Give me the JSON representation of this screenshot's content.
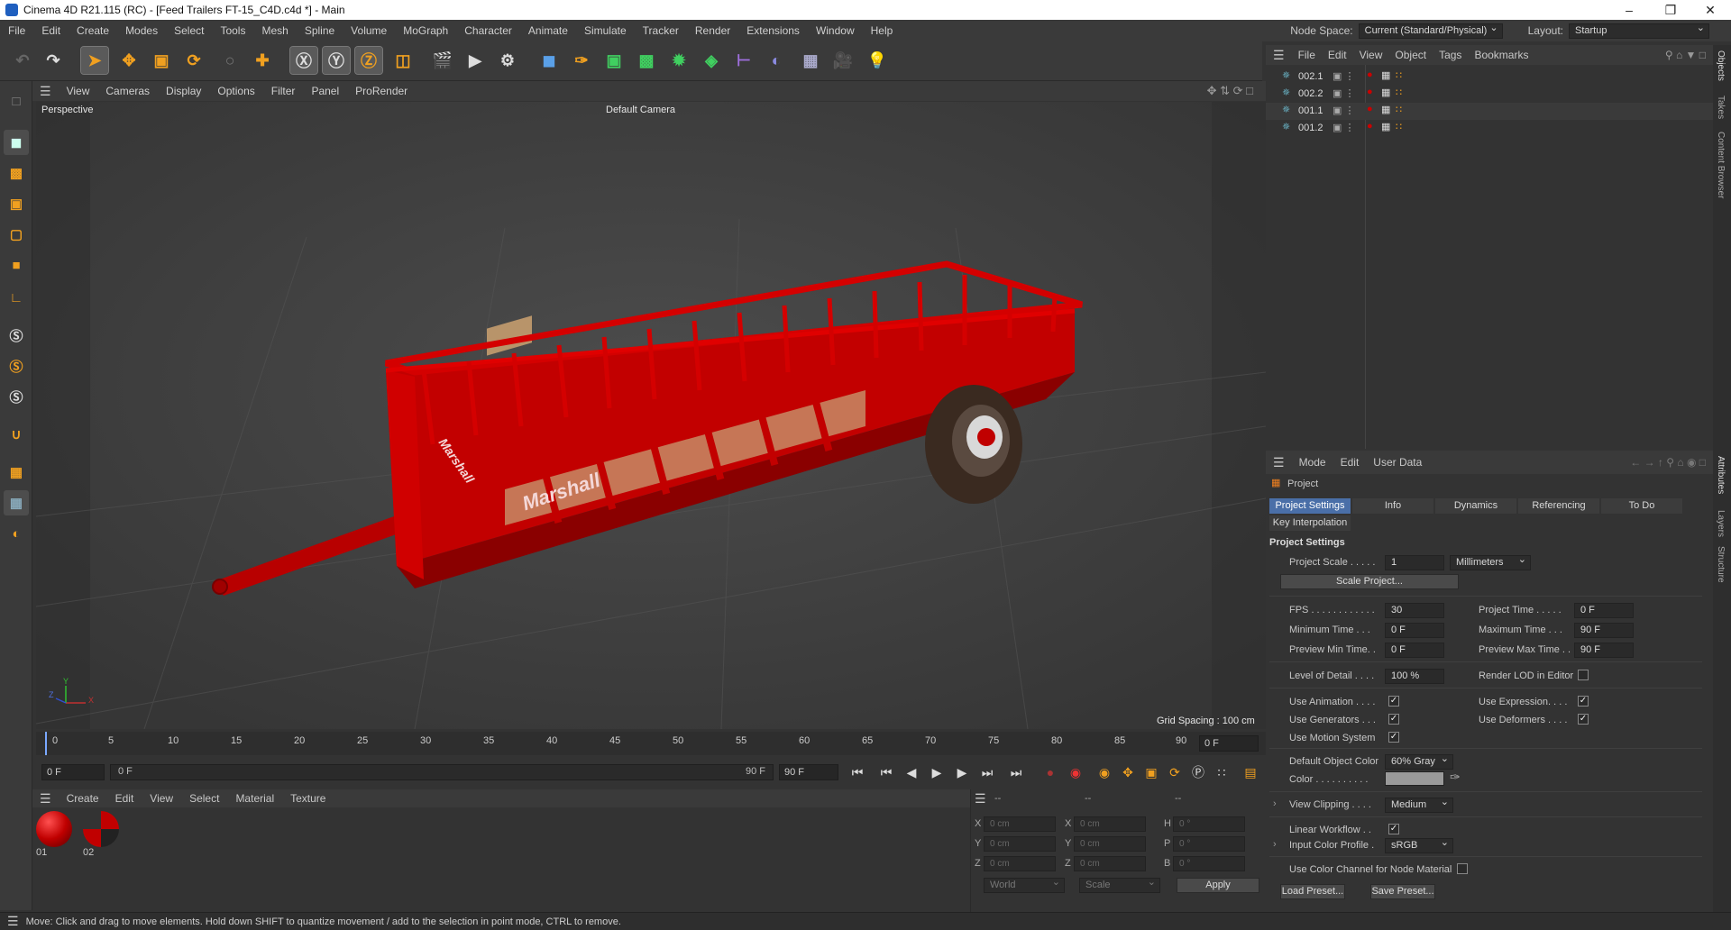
{
  "window": {
    "title": "Cinema 4D R21.115 (RC) - [Feed Trailers FT-15_C4D.c4d *] - Main"
  },
  "menubar": {
    "items": [
      "File",
      "Edit",
      "Create",
      "Modes",
      "Select",
      "Tools",
      "Mesh",
      "Spline",
      "Volume",
      "MoGraph",
      "Character",
      "Animate",
      "Simulate",
      "Tracker",
      "Render",
      "Extensions",
      "Window",
      "Help"
    ],
    "node_space_label": "Node Space:",
    "node_space_value": "Current (Standard/Physical)",
    "layout_label": "Layout:",
    "layout_value": "Startup"
  },
  "viewport": {
    "menu": [
      "View",
      "Cameras",
      "Display",
      "Options",
      "Filter",
      "Panel",
      "ProRender"
    ],
    "view_name": "Perspective",
    "camera": "Default Camera",
    "grid_spacing": "Grid Spacing : 100 cm",
    "trailer_brand": "Marshall",
    "axis": {
      "x": "X",
      "y": "Y",
      "z": "Z"
    }
  },
  "timeline": {
    "ticks": [
      "0",
      "5",
      "10",
      "15",
      "20",
      "25",
      "30",
      "35",
      "40",
      "45",
      "50",
      "55",
      "60",
      "65",
      "70",
      "75",
      "80",
      "85",
      "90"
    ],
    "current_frame": "0 F",
    "start_field": "0 F",
    "range_start": "0 F",
    "range_end": "90 F",
    "end_field": "90 F"
  },
  "material_manager": {
    "menu": [
      "Create",
      "Edit",
      "View",
      "Select",
      "Material",
      "Texture"
    ],
    "materials": [
      {
        "name": "01"
      },
      {
        "name": "02"
      }
    ]
  },
  "coordinates": {
    "header_dashes": [
      "--",
      "--",
      "--"
    ],
    "rows": [
      {
        "a": "X",
        "av": "0 cm",
        "b": "X",
        "bv": "0 cm",
        "c": "H",
        "cv": "0 °"
      },
      {
        "a": "Y",
        "av": "0 cm",
        "b": "Y",
        "bv": "0 cm",
        "c": "P",
        "cv": "0 °"
      },
      {
        "a": "Z",
        "av": "0 cm",
        "b": "Z",
        "bv": "0 cm",
        "c": "B",
        "cv": "0 °"
      }
    ],
    "world": "World",
    "scale": "Scale",
    "apply": "Apply"
  },
  "status": "Move: Click and drag to move elements. Hold down SHIFT to quantize movement / add to the selection in point mode, CTRL to remove.",
  "object_manager": {
    "menu": [
      "File",
      "Edit",
      "View",
      "Object",
      "Tags",
      "Bookmarks"
    ],
    "objects": [
      {
        "name": "002.1"
      },
      {
        "name": "002.2"
      },
      {
        "name": "001.1"
      },
      {
        "name": "001.2"
      }
    ]
  },
  "right_tabs": [
    "Objects",
    "Takes",
    "Content Browser",
    "Attributes",
    "Layers",
    "Structure"
  ],
  "attributes": {
    "menu": [
      "Mode",
      "Edit",
      "User Data"
    ],
    "object": "Project",
    "tabs": [
      "Project Settings",
      "Info",
      "Dynamics",
      "Referencing",
      "To Do"
    ],
    "tab2": "Key Interpolation",
    "section": "Project Settings",
    "project_scale_label": "Project Scale . . . . .",
    "project_scale": "1",
    "units": "Millimeters",
    "scale_project": "Scale Project...",
    "fps_label": "FPS . . . . . . . . . . . .",
    "fps": "30",
    "project_time_label": "Project Time . . . . .",
    "project_time": "0 F",
    "min_time_label": "Minimum Time . . .",
    "min_time": "0 F",
    "max_time_label": "Maximum Time . . .",
    "max_time": "90 F",
    "prev_min_label": "Preview Min Time. .",
    "prev_min": "0 F",
    "prev_max_label": "Preview Max Time . .",
    "prev_max": "90 F",
    "lod_label": "Level of Detail . . . .",
    "lod": "100 %",
    "render_lod_label": "Render LOD in Editor",
    "use_animation": "Use Animation . . . .",
    "use_expression": "Use Expression. . . .",
    "use_generators": "Use Generators . . .",
    "use_deformers": "Use Deformers . . . .",
    "use_motion": "Use Motion System",
    "default_color_label": "Default Object Color",
    "default_color": "60% Gray",
    "color_label": "Color . . . . . . . . . .",
    "view_clipping_label": "View Clipping . . . .",
    "view_clipping": "Medium",
    "linear_workflow": "Linear Workflow . .",
    "input_profile_label": "Input Color Profile .",
    "input_profile": "sRGB",
    "use_color_channel": "Use Color Channel for Node Material",
    "load_preset": "Load Preset...",
    "save_preset": "Save Preset..."
  },
  "colors": {
    "accent": "#4a6fa8",
    "trailer_red": "#c40000",
    "viewport_bg": "#404040"
  }
}
